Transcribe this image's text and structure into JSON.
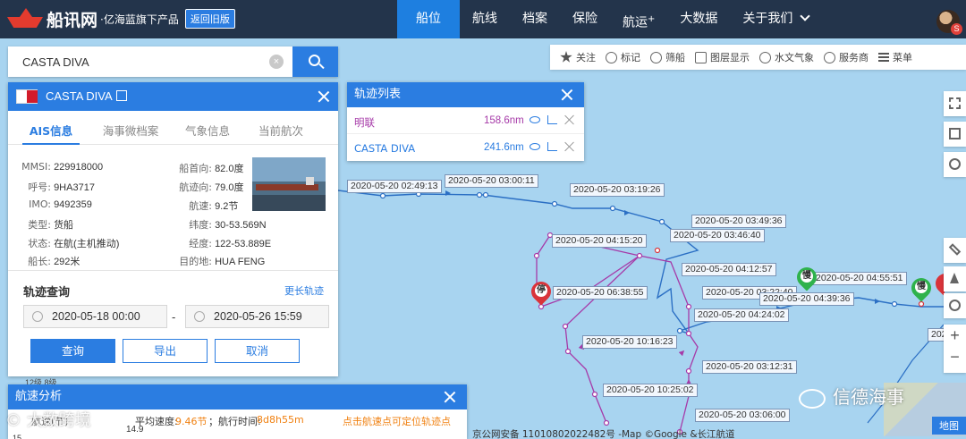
{
  "nav": {
    "brand": "船讯网",
    "brand_sub": "·亿海蓝旗下产品",
    "old_version": "返回旧版",
    "items": [
      {
        "label": "船位",
        "active": true
      },
      {
        "label": "航线"
      },
      {
        "label": "档案"
      },
      {
        "label": "保险"
      },
      {
        "label": "航运",
        "sup": "+"
      },
      {
        "label": "大数据"
      },
      {
        "label": "关于我们"
      }
    ],
    "avatar_badge": "S"
  },
  "search": {
    "value": "CASTA DIVA",
    "clear": "×"
  },
  "ship": {
    "name": "CASTA DIVA",
    "tabs": [
      "AIS信息",
      "海事微档案",
      "气象信息",
      "当前航次"
    ],
    "left": [
      {
        "k": "MMSI:",
        "v": "229918000"
      },
      {
        "k": "呼号:",
        "v": "9HA3717"
      },
      {
        "k": "IMO:",
        "v": "9492359"
      },
      {
        "k": "类型:",
        "v": "货船"
      },
      {
        "k": "状态:",
        "v": "在航(主机推动)"
      },
      {
        "k": "船长:",
        "v": "292米"
      }
    ],
    "right": [
      {
        "k": "船首向:",
        "v": "82.0度"
      },
      {
        "k": "航迹向:",
        "v": "79.0度"
      },
      {
        "k": "航速:",
        "v": "9.2节"
      },
      {
        "k": "纬度:",
        "v": "30-53.569N"
      },
      {
        "k": "经度:",
        "v": "122-53.889E"
      },
      {
        "k": "目的地:",
        "v": "HUA FENG"
      }
    ],
    "track_query": {
      "title": "轨迹查询",
      "longer": "更长轨迹",
      "start": "2020-05-18 00:00",
      "end": "2020-05-26 15:59",
      "dash": "-",
      "query": "查询",
      "export": "导出",
      "cancel": "取消"
    }
  },
  "tracks": {
    "title": "轨迹列表",
    "rows": [
      {
        "name": "明联",
        "dist": "158.6nm",
        "color": "#a63aa8"
      },
      {
        "name": "CASTA DIVA",
        "dist": "241.6nm",
        "color": "#2b7de1"
      }
    ]
  },
  "toolbar": [
    "关注",
    "标记",
    "筛船",
    "图层显示",
    "水文气象",
    "服务商",
    "菜单"
  ],
  "map": {
    "labels": [
      "2020-05-20 02:49:13",
      "2020-05-20 03:00:11",
      "2020-05-20 03:19:26",
      "2020-05-20 03:49:36",
      "2020-05-20 04:15:20",
      "2020-05-20 03:46:40",
      "2020-05-20 04:12:57",
      "2020-05-20 04:55:51",
      "2020-05-20 06:38:55",
      "2020-05-20 03:22:40",
      "2020-05-20 04:39:36",
      "2020-05-20 04:24:02",
      "2020-05-20 10:16:23",
      "2020-05-20 03:12:31",
      "2020-05-20 10:25:02",
      "2020-05-20 03:06:00"
    ],
    "pins": {
      "stop": "停",
      "slow": "慢"
    },
    "edge_label": "2020"
  },
  "speed": {
    "title": "航速分析",
    "speed_label": "航速(节)",
    "avg_label": "平均速度:",
    "avg_value": "9.46节",
    "time_label": "；航行时间:",
    "time_value": "8d8h55m",
    "hint": "点击航速点可定位轨迹点"
  },
  "footer": "京公网安备 11010802022482号 -Map ©Google &长江航道",
  "watermarks": {
    "left": "© 大数跨境",
    "right": "信德海事"
  },
  "maptype": "地图",
  "under": {
    "a": "12级   8级",
    "b": "14.9",
    "c": "15"
  }
}
